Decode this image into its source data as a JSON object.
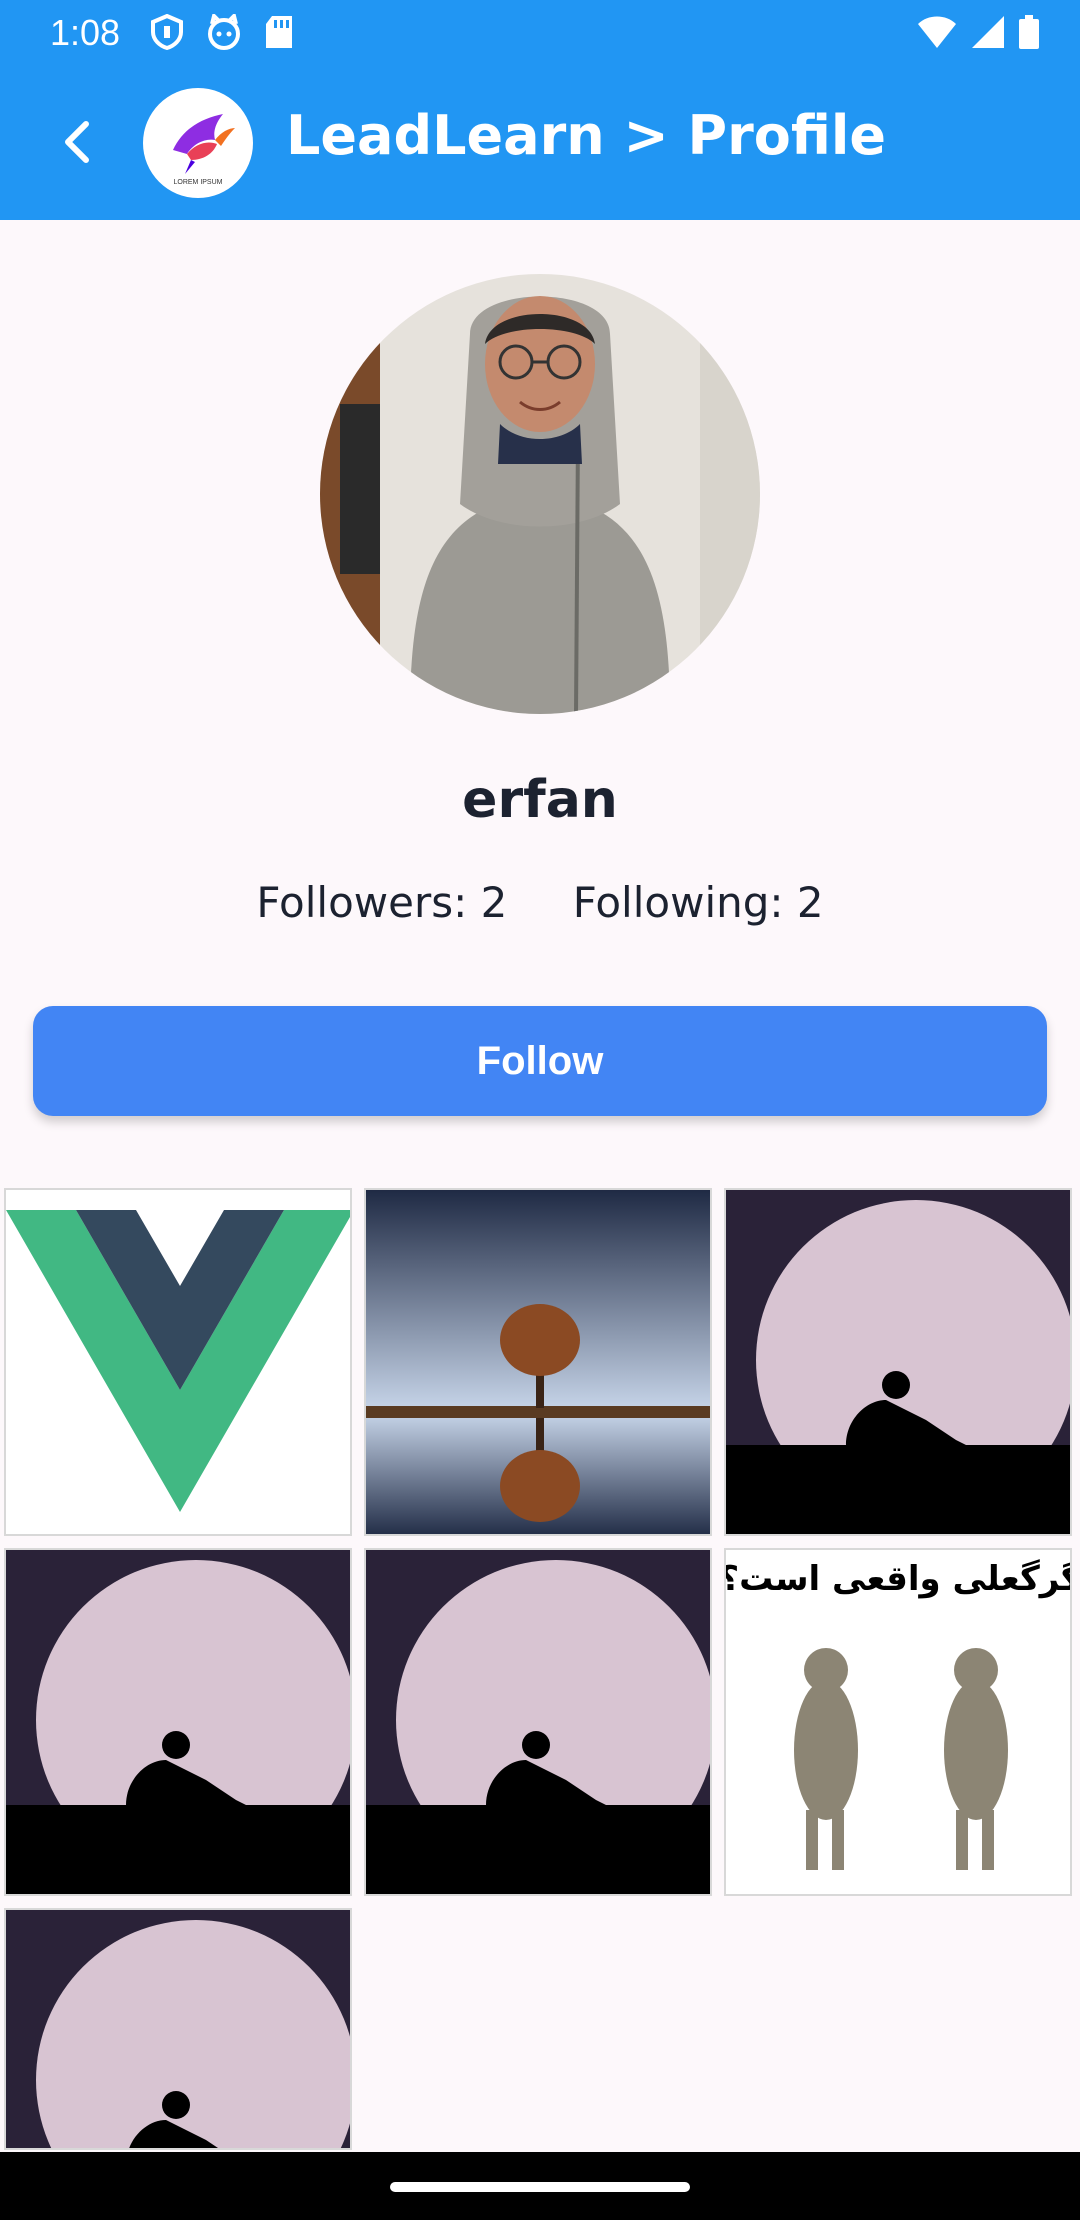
{
  "status_bar": {
    "time": "1:08",
    "left_icons": [
      "shield-icon",
      "cat-icon",
      "sd-card-icon"
    ],
    "right_icons": [
      "wifi-icon",
      "signal-icon",
      "battery-icon"
    ]
  },
  "app_bar": {
    "title": "LeadLearn > Profile",
    "back_icon": "chevron-left-icon",
    "logo_text": "LOREM IPSUM",
    "color": "#2196f3"
  },
  "profile": {
    "username": "erfan",
    "followers_label": "Followers: 2",
    "following_label": "Following: 2"
  },
  "follow_button": {
    "label": "Follow",
    "color": "#4285f4"
  },
  "posts": [
    {
      "kind": "vue-logo"
    },
    {
      "kind": "tree-reflection"
    },
    {
      "kind": "moon-silhouette"
    },
    {
      "kind": "moon-silhouette"
    },
    {
      "kind": "moon-silhouette"
    },
    {
      "kind": "wolf-meme",
      "caption": "گرگعلی واقعی است؟"
    },
    {
      "kind": "moon-silhouette"
    }
  ]
}
